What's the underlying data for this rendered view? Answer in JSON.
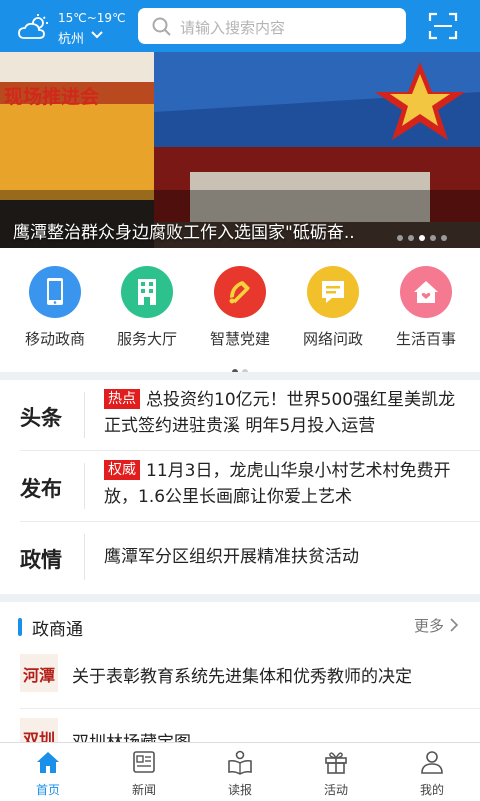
{
  "header": {
    "temperature": "15℃~19℃",
    "city": "杭州",
    "search_placeholder": "请输入搜索内容"
  },
  "banner": {
    "sign_text": "现场推进会",
    "caption": "鹰潭整治群众身边腐败工作入选国家\"砥砺奋.."
  },
  "quick_links": [
    {
      "label": "移动政商",
      "icon": "mobile-icon",
      "color": "#3a95ee"
    },
    {
      "label": "服务大厅",
      "icon": "building-icon",
      "color": "#2dc18d"
    },
    {
      "label": "智慧党建",
      "icon": "party-emblem-icon",
      "color": "#e8372c"
    },
    {
      "label": "网络问政",
      "icon": "chat-icon",
      "color": "#f1c02a"
    },
    {
      "label": "生活百事",
      "icon": "home-icon",
      "color": "#f57a91"
    }
  ],
  "news": [
    {
      "category": "头条",
      "tag": "热点",
      "text": "总投资约10亿元！世界500强红星美凯龙正式签约进驻贵溪 明年5月投入运营"
    },
    {
      "category": "发布",
      "tag": "权威",
      "text": "11月3日，龙虎山华泉小村艺术村免费开放，1.6公里长画廊让你爱上艺术"
    },
    {
      "category": "政情",
      "tag": "",
      "text": "鹰潭军分区组织开展精准扶贫活动"
    }
  ],
  "zhengshangtong": {
    "title": "政商通",
    "more": "更多",
    "items": [
      {
        "logo_text": "河潭",
        "text": "关于表彰教育系统先进集体和优秀教师的决定"
      },
      {
        "logo_text": "双圳",
        "text": "双圳林场藏宝图"
      }
    ]
  },
  "tabs": [
    {
      "label": "首页",
      "icon": "home-icon",
      "active": true
    },
    {
      "label": "新闻",
      "icon": "newspaper-icon",
      "active": false
    },
    {
      "label": "读报",
      "icon": "reading-icon",
      "active": false
    },
    {
      "label": "活动",
      "icon": "gift-icon",
      "active": false
    },
    {
      "label": "我的",
      "icon": "user-icon",
      "active": false
    }
  ],
  "colors": {
    "primary": "#1a90e8",
    "tag_red": "#e11d1d"
  }
}
